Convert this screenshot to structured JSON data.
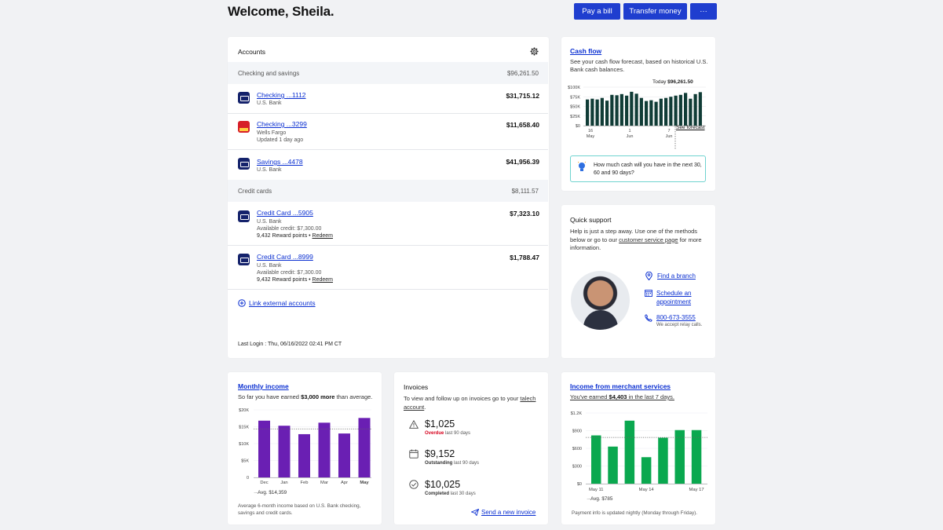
{
  "header": {
    "welcome": "Welcome, Sheila.",
    "pay_bill": "Pay a bill",
    "transfer": "Transfer money",
    "more": "···"
  },
  "accounts": {
    "title": "Accounts",
    "checking_savings_label": "Checking and savings",
    "checking_savings_total": "$96,261.50",
    "items": [
      {
        "name": "Checking ...1112",
        "bank": "U.S. Bank",
        "amount": "$31,715.12"
      },
      {
        "name": "Checking ...3299",
        "bank": "Wells Fargo",
        "sub": "Updated 1 day ago",
        "amount": "$11,658.40"
      },
      {
        "name": "Savings ...4478",
        "bank": "U.S. Bank",
        "amount": "$41,956.39"
      }
    ],
    "credit_label": "Credit cards",
    "credit_total": "$8,111.57",
    "cards": [
      {
        "name": "Credit Card ...5905",
        "bank": "U.S. Bank",
        "available": "Available credit: $7,300.00",
        "points": "9,432 Reward points • ",
        "redeem": "Redeem",
        "amount": "$7,323.10"
      },
      {
        "name": "Credit Card ...8999",
        "bank": "U.S. Bank",
        "available": "Available credit: $7,300.00",
        "points": "9,432 Reward points • ",
        "redeem": "Redeem",
        "amount": "$1,788.47"
      }
    ],
    "link_external": "Link external accounts",
    "last_login": "Last Login : Thu, 06/16/2022 02:41 PM  CT"
  },
  "cashflow": {
    "title": "Cash flow",
    "desc": "See your cash flow forecast, based on historical U.S. Bank cash balances.",
    "today_prefix": "Today ",
    "today_value": "$96,261.50",
    "see_forecast": "See forecast",
    "prompt": "How much cash will you have in the next 30, 60 and 90 days?"
  },
  "support": {
    "title": "Quick support",
    "desc_1": "Help is just a step away. Use one of the methods below or go to our ",
    "desc_link": "customer service page",
    "desc_2": " for more information.",
    "find_branch": "Find a branch",
    "schedule": "Schedule an appointment",
    "phone": "800-673-3555",
    "relay": "We accept relay calls."
  },
  "monthly": {
    "title": "Monthly income",
    "desc_1": "So far you have earned ",
    "desc_bold": "$3,000 more",
    "desc_2": " than average.",
    "avg_label": "Avg. $14,359",
    "footer": "Average 6-month income based on U.S. Bank checking, savings and credit cards."
  },
  "invoices": {
    "title": "Invoices",
    "desc_1": "To view and follow up on invoices go to your ",
    "desc_link": "talech account",
    "desc_2": ".",
    "items": [
      {
        "amount": "$1,025",
        "status": "Overdue",
        "period": " last 90 days"
      },
      {
        "amount": "$9,152",
        "status": "Outstanding",
        "period": " last 90 days"
      },
      {
        "amount": "$10,025",
        "status": "Completed",
        "period": " last 30 days"
      }
    ],
    "send": "Send a new invoice"
  },
  "merchant": {
    "title": "Income from merchant services",
    "desc_1": "You've earned ",
    "desc_bold": "$4,403",
    "desc_2": " in the last 7 days.",
    "avg_label": "Avg. $785",
    "footer": "Payment info is updated nightly (Monday through Friday)."
  },
  "colors": {
    "accent": "#1f3ecf",
    "cashflow_bar": "#103c36",
    "monthly_bar": "#6a1fb3",
    "merchant_bar": "#0aa84f",
    "overdue": "#d6001c"
  },
  "chart_data": [
    {
      "type": "bar",
      "title": "Cash flow",
      "ylabel": "",
      "ytick_labels": [
        "$100K",
        "$75K",
        "$50K",
        "$25K",
        "$0"
      ],
      "xtick_labels": [
        "16\nMay",
        "1\nJun",
        "7\nJun"
      ],
      "ylim": [
        0,
        100000
      ],
      "values": [
        68000,
        70000,
        68000,
        72000,
        65000,
        80000,
        79000,
        82000,
        78000,
        88000,
        83000,
        72000,
        64000,
        66000,
        62000,
        70000,
        72000,
        75000,
        78000,
        80000,
        85000,
        70000,
        82000,
        87000
      ]
    },
    {
      "type": "bar",
      "title": "Monthly income",
      "categories": [
        "Dec",
        "Jan",
        "Feb",
        "Mar",
        "Apr",
        "May"
      ],
      "values": [
        16800,
        15300,
        12800,
        16200,
        13000,
        17600
      ],
      "ytick_labels": [
        "$20K",
        "$15K",
        "$10K",
        "$5K",
        "0"
      ],
      "ylim": [
        0,
        20000
      ],
      "average": 14359
    },
    {
      "type": "bar",
      "title": "Income from merchant services",
      "values": [
        820,
        630,
        1070,
        450,
        780,
        910,
        910
      ],
      "xtick_labels": [
        "May 11",
        "May 14",
        "May 17"
      ],
      "ytick_labels": [
        "$1.2K",
        "$900",
        "$600",
        "$300",
        "$0"
      ],
      "ylim": [
        0,
        1200
      ],
      "average": 785
    }
  ]
}
